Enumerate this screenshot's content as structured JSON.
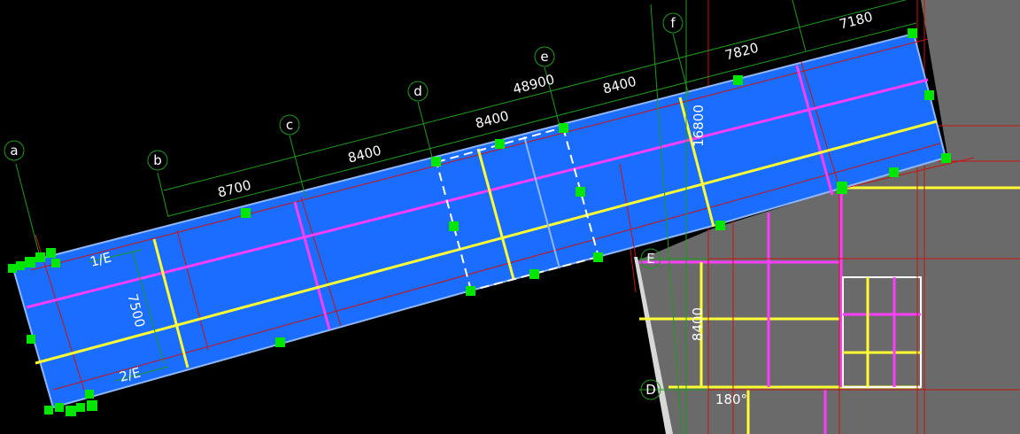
{
  "colors": {
    "background": "#000000",
    "floor_fill": "#1a6dff",
    "floor_outline": "#8fb6ff",
    "existing_fill": "#6a6a6a",
    "beam_primary": "#ff3dff",
    "beam_secondary": "#ffff33",
    "grid_line": "#cc1111",
    "dimension_line": "#1f9a1f",
    "grip": "#00e600",
    "text": "#ffffff"
  },
  "axis_labels": {
    "a": "a",
    "b": "b",
    "c": "c",
    "d": "d",
    "e": "e",
    "f": "f",
    "E": "E",
    "D": "D"
  },
  "dimensions": {
    "bc": "8700",
    "cd": "8400",
    "de": "8400",
    "overall": "48900",
    "ef": "8400",
    "f_next": "7820",
    "last": "7180",
    "depth": "7500",
    "span_16800": "16800",
    "ED": "8400"
  },
  "grid_refs": {
    "row1": "1/E",
    "row2": "2/E"
  },
  "angle_label": "180°",
  "icons": {
    "grip": "square-grip-icon",
    "axis_bubble": "axis-bubble-icon"
  }
}
